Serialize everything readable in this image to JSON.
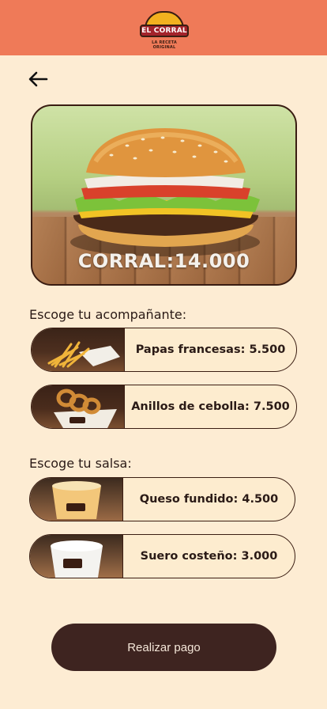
{
  "header": {
    "brand_name": "EL CORRAL",
    "brand_tagline": "LA RECETA ORIGINAL",
    "background": "#ef7a58"
  },
  "back": {
    "icon": "arrow-left-icon"
  },
  "product": {
    "price_text": "CORRAL:14.000"
  },
  "sides": {
    "label": "Escoge tu acompañante:",
    "items": [
      {
        "label": "Papas francesas: 5.500"
      },
      {
        "label": "Anillos de cebolla: 7.500"
      }
    ]
  },
  "sauces": {
    "label": "Escoge tu salsa:",
    "items": [
      {
        "label": "Queso fundido: 4.500"
      },
      {
        "label": "Suero costeño: 3.000"
      }
    ]
  },
  "checkout": {
    "button_label": "Realizar pago",
    "color": "#3e2420"
  }
}
